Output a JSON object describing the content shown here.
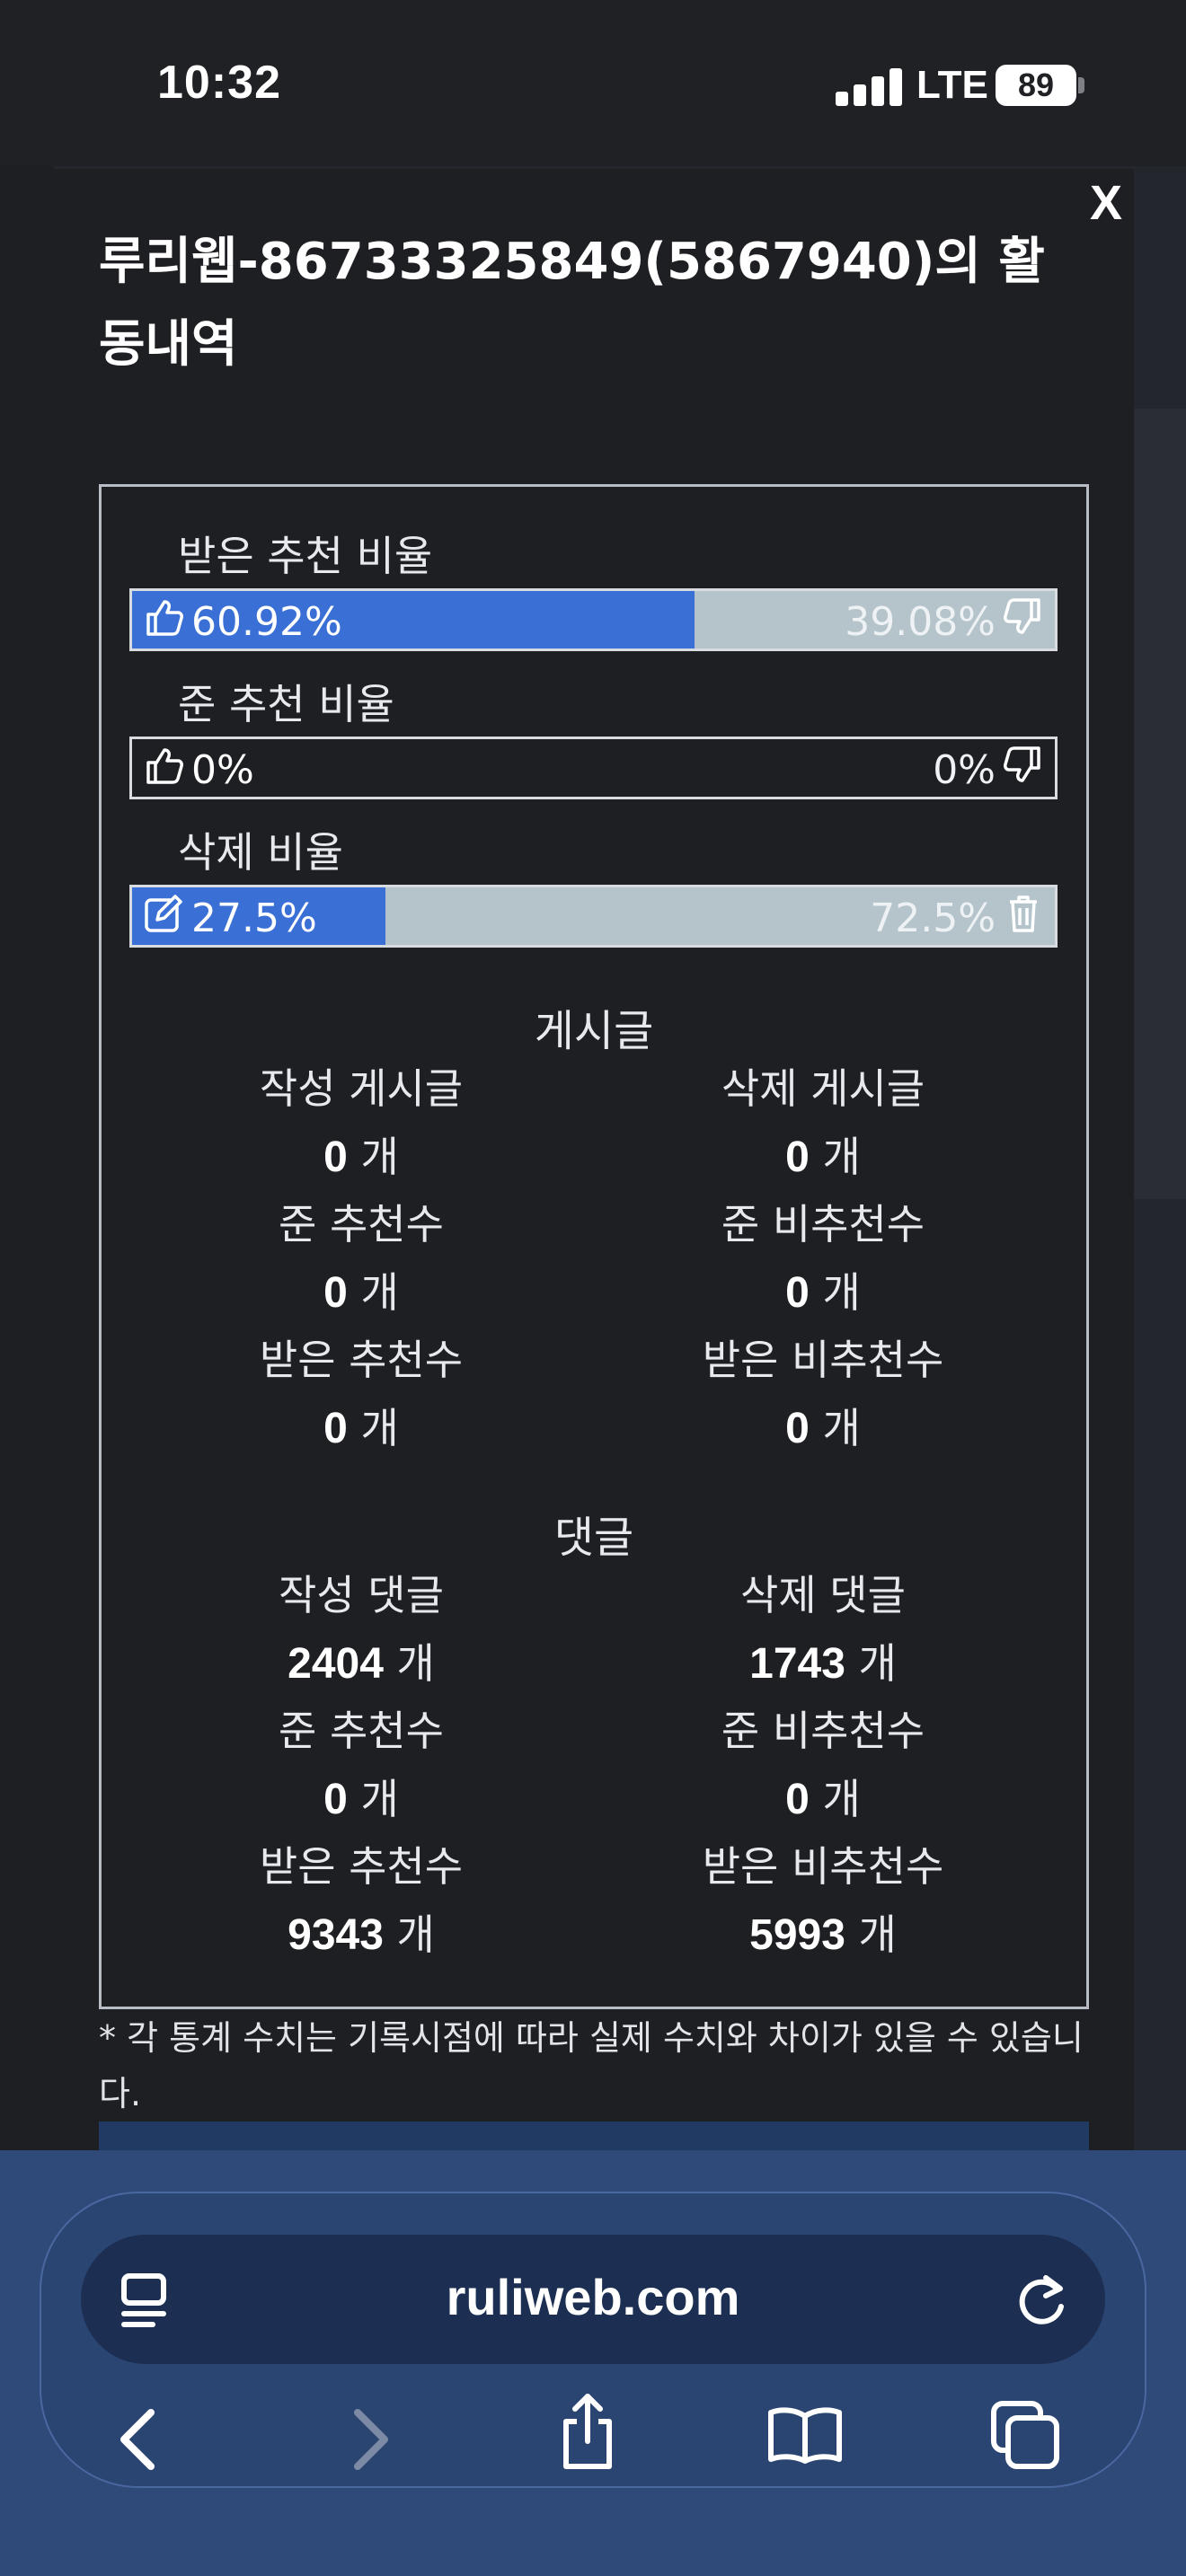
{
  "status_bar": {
    "time": "10:32",
    "network": "LTE",
    "battery": "89"
  },
  "modal": {
    "close_label": "X",
    "title": "루리웹-86733325849(5867940)의 활동내역"
  },
  "ratios": [
    {
      "label": "받은 추천 비율",
      "left_value": "60.92%",
      "right_value": "39.08%",
      "fill": 60.92,
      "left_icon": "thumbs-up-icon",
      "right_icon": "thumbs-down-icon"
    },
    {
      "label": "준 추천 비율",
      "left_value": "0%",
      "right_value": "0%",
      "fill": 0,
      "left_icon": "thumbs-up-icon",
      "right_icon": "thumbs-down-icon"
    },
    {
      "label": "삭제 비율",
      "left_value": "27.5%",
      "right_value": "72.5%",
      "fill": 27.5,
      "left_icon": "edit-icon",
      "right_icon": "trash-icon"
    }
  ],
  "posts": {
    "title": "게시글",
    "unit": "개",
    "rows": [
      {
        "left_label": "작성 게시글",
        "left_value": "0",
        "right_label": "삭제 게시글",
        "right_value": "0"
      },
      {
        "left_label": "준 추천수",
        "left_value": "0",
        "right_label": "준 비추천수",
        "right_value": "0"
      },
      {
        "left_label": "받은 추천수",
        "left_value": "0",
        "right_label": "받은 비추천수",
        "right_value": "0"
      }
    ]
  },
  "comments": {
    "title": "댓글",
    "unit": "개",
    "rows": [
      {
        "left_label": "작성 댓글",
        "left_value": "2404",
        "right_label": "삭제 댓글",
        "right_value": "1743"
      },
      {
        "left_label": "준 추천수",
        "left_value": "0",
        "right_label": "준 비추천수",
        "right_value": "0"
      },
      {
        "left_label": "받은 추천수",
        "left_value": "9343",
        "right_label": "받은 비추천수",
        "right_value": "5993"
      }
    ]
  },
  "footnote": "* 각 통계 수치는 기록시점에 따라 실제 수치와 차이가 있을 수 있습니다.",
  "browser": {
    "url": "ruliweb.com"
  }
}
